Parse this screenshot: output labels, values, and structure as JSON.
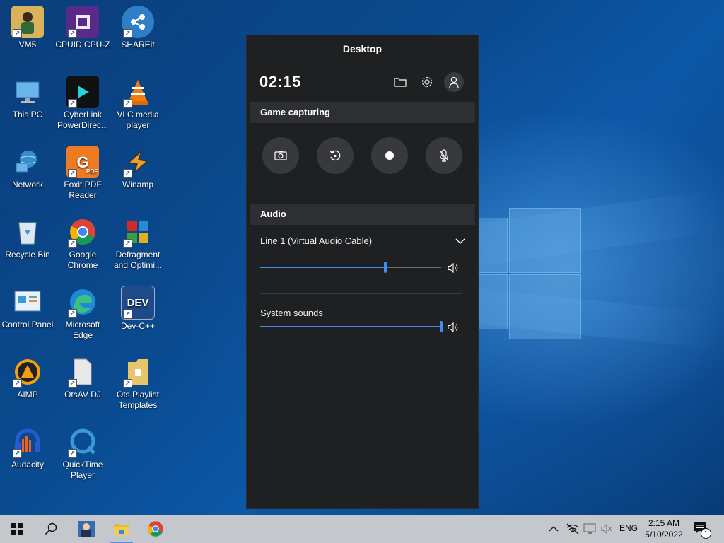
{
  "desktop": {
    "icons": [
      {
        "label": "VM5",
        "name": "vm5-icon"
      },
      {
        "label": "CPUID CPU-Z",
        "name": "cpuz-icon"
      },
      {
        "label": "SHAREit",
        "name": "shareit-icon"
      },
      {
        "label": "This PC",
        "name": "this-pc-icon"
      },
      {
        "label": "CyberLink PowerDirec...",
        "name": "powerdirector-icon"
      },
      {
        "label": "VLC media player",
        "name": "vlc-icon"
      },
      {
        "label": "Network",
        "name": "network-icon"
      },
      {
        "label": "Foxit PDF Reader",
        "name": "foxit-icon"
      },
      {
        "label": "Winamp",
        "name": "winamp-icon"
      },
      {
        "label": "Recycle Bin",
        "name": "recycle-bin-icon"
      },
      {
        "label": "Google Chrome",
        "name": "chrome-icon"
      },
      {
        "label": "Defragment and Optimi...",
        "name": "defragment-icon"
      },
      {
        "label": "Control Panel",
        "name": "control-panel-icon"
      },
      {
        "label": "Microsoft Edge",
        "name": "edge-icon"
      },
      {
        "label": "Dev-C++",
        "name": "devcpp-icon"
      },
      {
        "label": "AIMP",
        "name": "aimp-icon"
      },
      {
        "label": "OtsAV DJ",
        "name": "otsav-icon"
      },
      {
        "label": "Ots Playlist Templates",
        "name": "ots-playlist-icon"
      },
      {
        "label": "Audacity",
        "name": "audacity-icon"
      },
      {
        "label": "QuickTime Player",
        "name": "quicktime-icon"
      }
    ],
    "devcpp_badge": "DEV",
    "pdf_badge": "PDF"
  },
  "gamebar": {
    "title": "Desktop",
    "clock": "02:15",
    "capture_section": "Game capturing",
    "audio_section": "Audio",
    "audio": {
      "device_label": "Line 1 (Virtual Audio Cable)",
      "device_level": 0.69,
      "system_label": "System sounds",
      "system_level": 1.0
    },
    "accent_color": "#3f8ff0"
  },
  "taskbar": {
    "language": "ENG",
    "time": "2:15 AM",
    "date": "5/10/2022",
    "notification_count": "1"
  }
}
